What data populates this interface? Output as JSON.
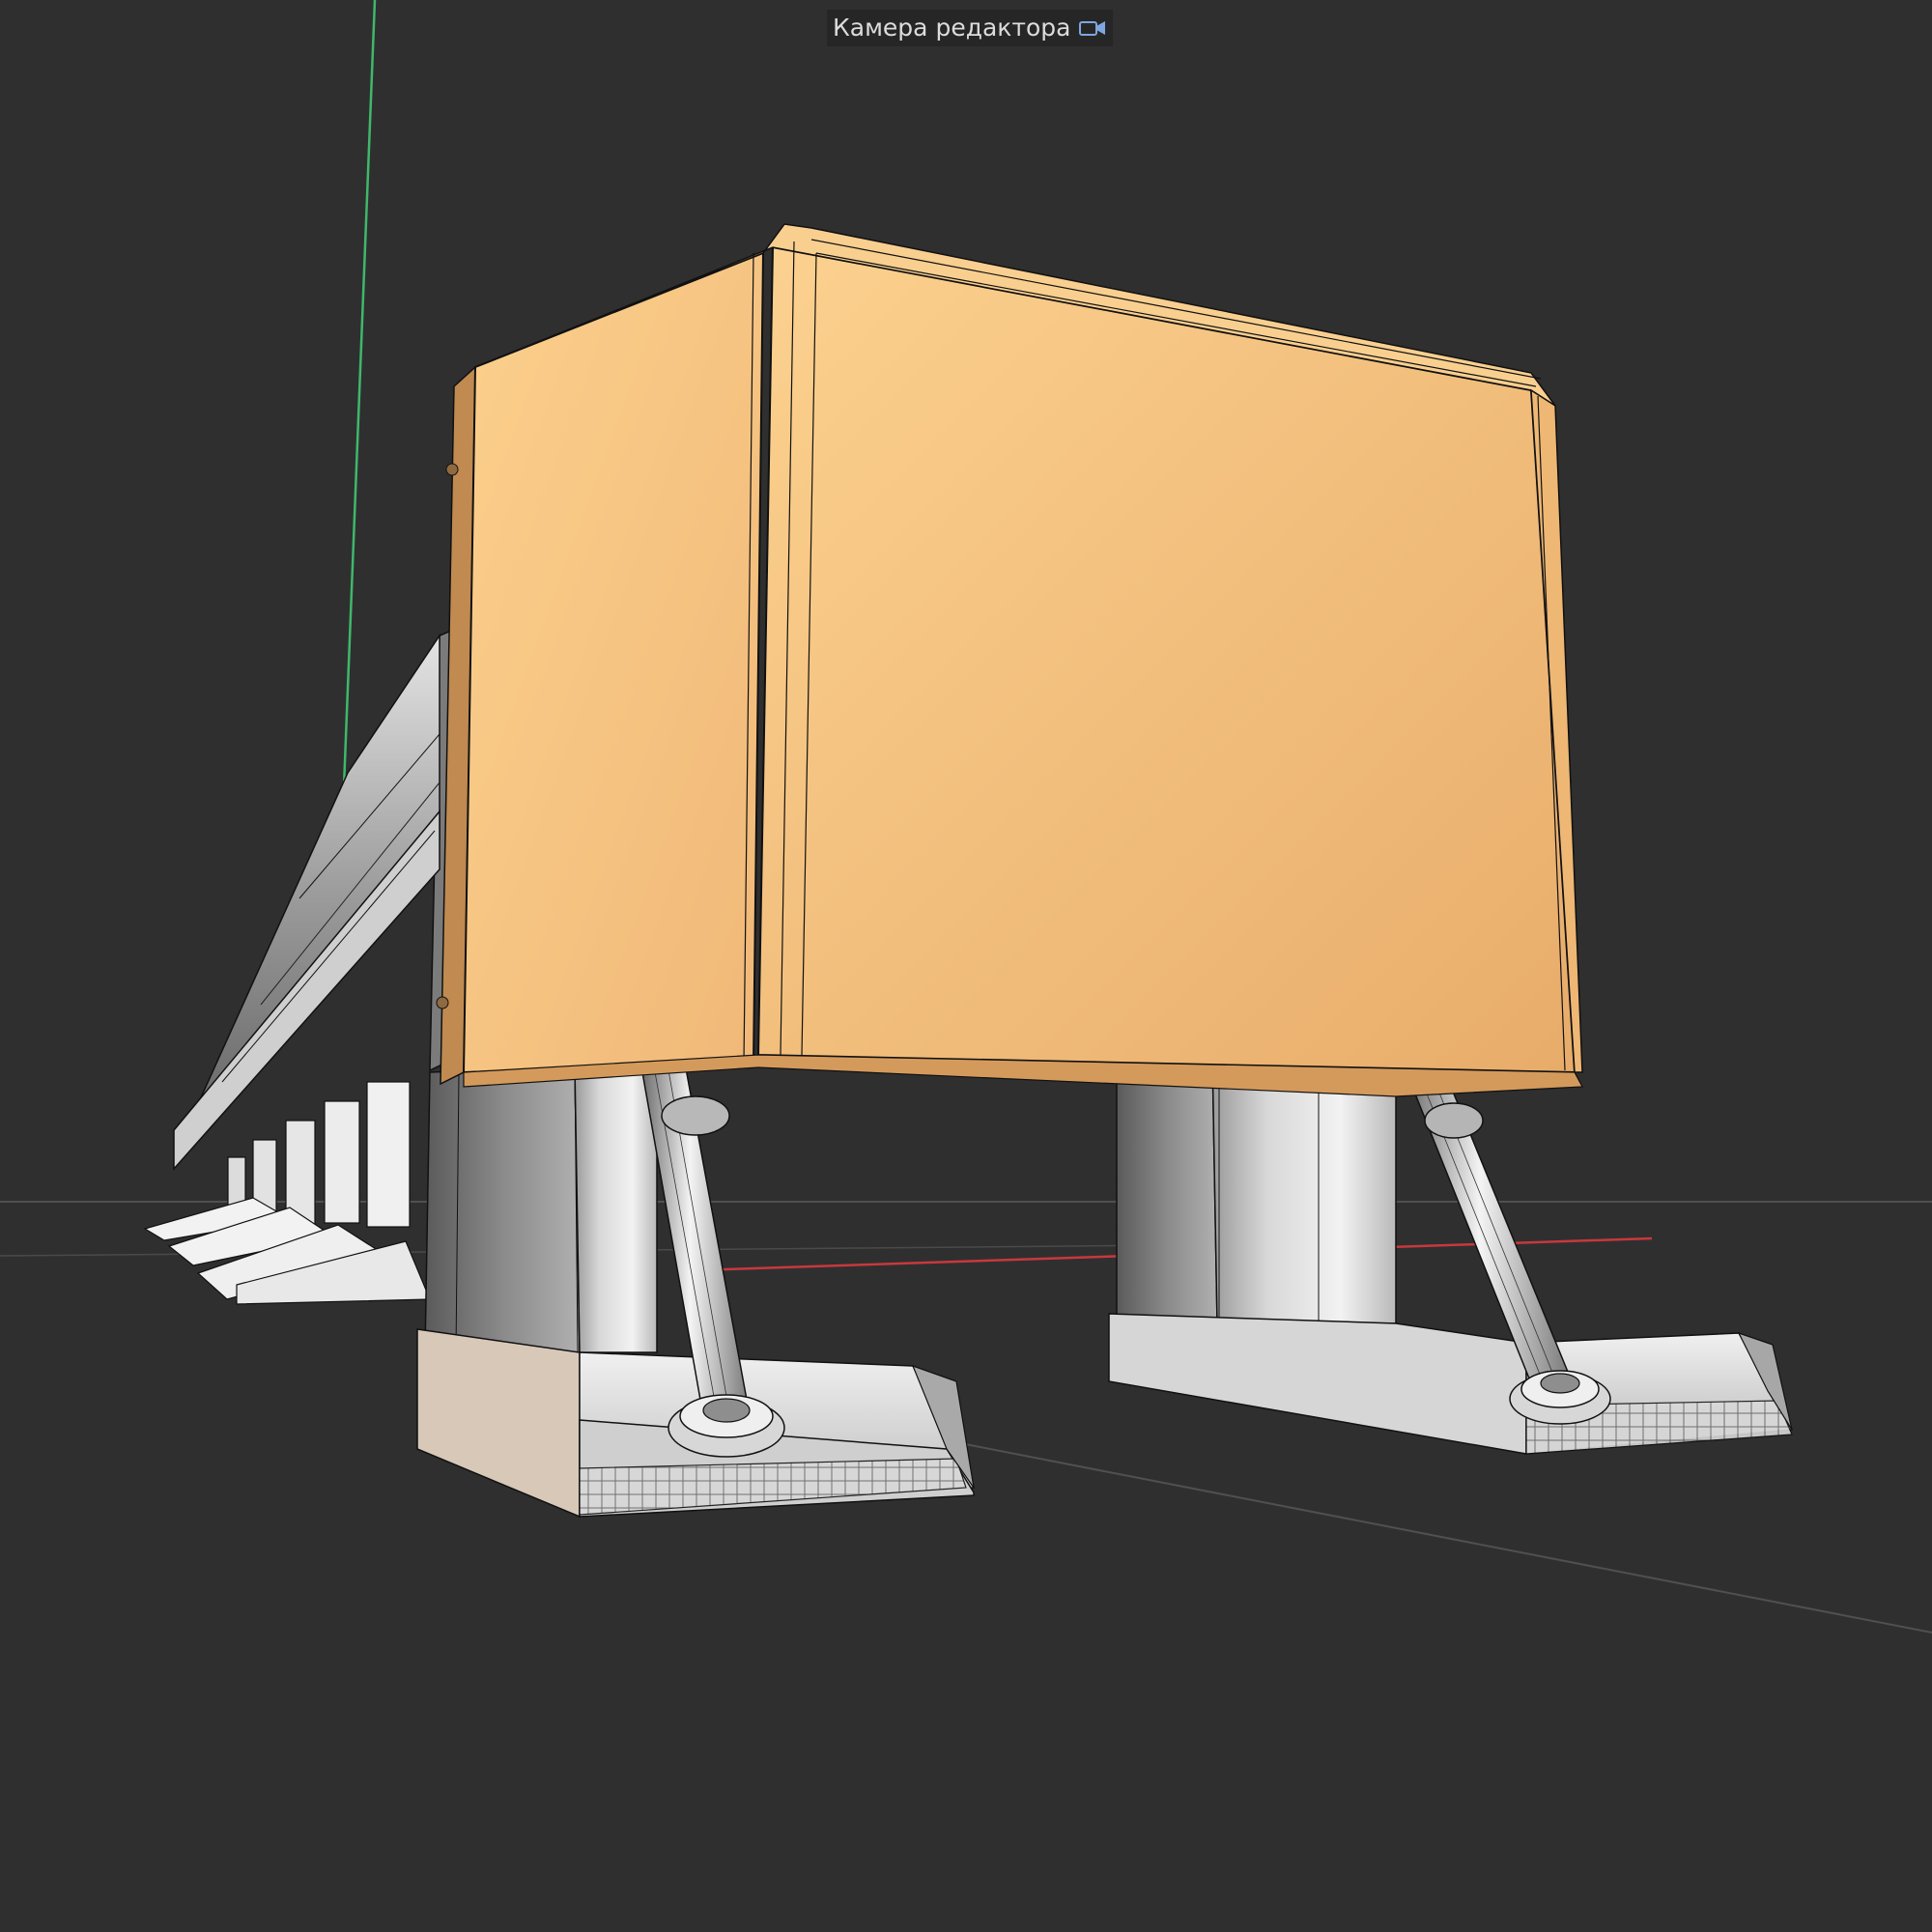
{
  "viewport": {
    "camera_label": "Камера редактора",
    "camera_icon": "camera-icon",
    "background_color": "#2f2f30"
  },
  "scene": {
    "selected_object_color": "#f5c27c",
    "axis_colors": {
      "y_axis": "#3fb86a",
      "x_axis": "#c8383c"
    },
    "mesh_color": "#d9d9d9",
    "wire_color": "#111111"
  }
}
